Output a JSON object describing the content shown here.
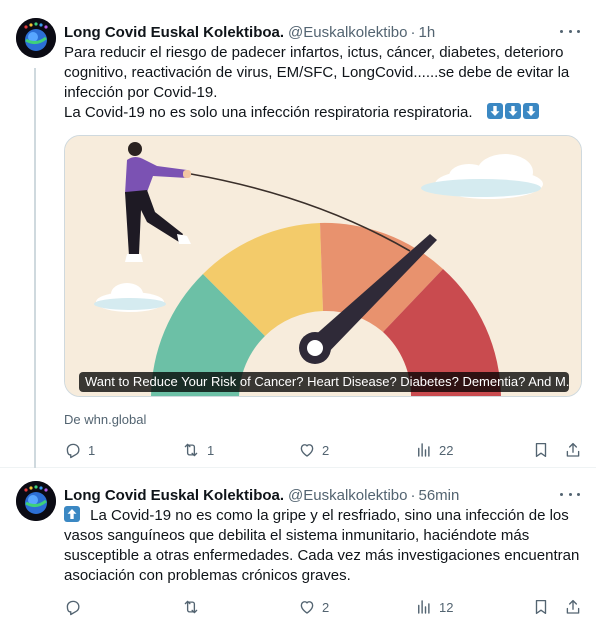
{
  "tweets": [
    {
      "author": "Long Covid Euskal Kolektiboa.",
      "handle": "@Euskalkolektibo",
      "separator": "·",
      "time": "1h",
      "text_lines": [
        "Para reducir el riesgo de padecer infartos, ictus, cáncer, diabetes, deterioro",
        "cognitivo, reactivación de virus, EM/SFC, LongCovid......se debe de evitar la",
        "infección por Covid-19.",
        "La Covid-19 no es solo una infección respiratoria respiratoria."
      ],
      "trailing_emoji": "down-arrow-emoji x3",
      "card": {
        "caption": "Want to Reduce Your Risk of Cancer? Heart Disease? Diabetes? Dementia? And M...",
        "image_icon": "risk-gauge-illustration",
        "colors": {
          "gauge_green": "#6cc0a6",
          "gauge_yellow": "#f3cb6a",
          "gauge_orange": "#e8926e",
          "gauge_red": "#c94b4f",
          "needle": "#2f2a38"
        }
      },
      "source": "De whn.global",
      "stats": {
        "replies": "1",
        "reposts": "1",
        "likes": "2",
        "views": "22"
      }
    },
    {
      "author": "Long Covid Euskal Kolektiboa.",
      "handle": "@Euskalkolektibo",
      "separator": "·",
      "time": "56min",
      "text_lines": [
        "La Covid-19 no es como la gripe y el resfriado, sino una infección de los",
        "vasos sanguíneos que debilita el sistema inmunitario, haciéndote más",
        "susceptible a otras enfermedades. Cada vez más investigaciones encuentran",
        "asociación con problemas crónicos graves."
      ],
      "leading_emoji": "up-arrow-emoji",
      "stats": {
        "replies": "",
        "reposts": "",
        "likes": "2",
        "views": "12"
      }
    }
  ],
  "icons": [
    "reply-icon",
    "repost-icon",
    "like-icon",
    "views-icon",
    "bookmark-icon",
    "share-icon",
    "more-icon"
  ],
  "colors": {
    "text": "#0f1419",
    "muted": "#536471",
    "emoji_blue": "#3b88c3",
    "divider": "#eff3f4"
  }
}
